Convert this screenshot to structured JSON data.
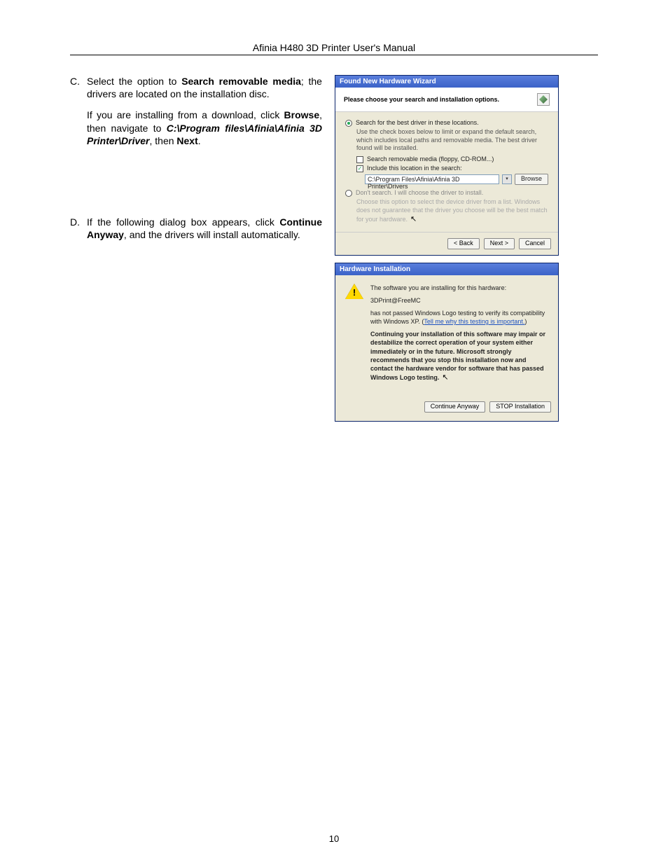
{
  "header": "Afinia H480 3D Printer User's Manual",
  "pageNumber": "10",
  "stepC": {
    "letter": "C.",
    "p1a": "Select the option to ",
    "p1b": "Search removable media",
    "p1c": "; the drivers are located on the installation disc.",
    "p2a": "If you are installing from a download, click ",
    "p2b": "Browse",
    "p2c": ", then navigate to ",
    "p2d": "C:\\Program files\\Afinia\\Afinia 3D Printer\\Driver",
    "p2e": ", then ",
    "p2f": "Next",
    "p2g": "."
  },
  "stepD": {
    "letter": "D.",
    "p1a": "If the following dialog box appears, click ",
    "p1b": "Continue Anyway",
    "p1c": ", and the drivers will install automatically."
  },
  "wizard": {
    "title": "Found New Hardware Wizard",
    "heading": "Please choose your search and installation options.",
    "opt1": "Search for the best driver in these locations.",
    "opt1sub": "Use the check boxes below to limit or expand the default search, which includes local paths and removable media. The best driver found will be installed.",
    "chk1": "Search removable media (floppy, CD-ROM...)",
    "chk2": "Include this location in the search:",
    "path": "C:\\Program Files\\Afinia\\Afinia 3D Printer\\Drivers",
    "browse": "Browse",
    "opt2": "Don't search. I will choose the driver to install.",
    "opt2sub": "Choose this option to select the device driver from a list. Windows does not guarantee that the driver you choose will be the best match for your hardware.",
    "back": "< Back",
    "next": "Next >",
    "cancel": "Cancel"
  },
  "hw": {
    "title": "Hardware Installation",
    "line1": "The software you are installing for this hardware:",
    "line2": "3DPrint@FreeMC",
    "line3a": "has not passed Windows Logo testing to verify its compatibility with Windows XP. (",
    "line3link": "Tell me why this testing is important.",
    "line3b": ")",
    "warn": "Continuing your installation of this software may impair or destabilize the correct operation of your system either immediately or in the future. Microsoft strongly recommends that you stop this installation now and contact the hardware vendor for software that has passed Windows Logo testing.",
    "cont": "Continue Anyway",
    "stop": "STOP Installation"
  }
}
